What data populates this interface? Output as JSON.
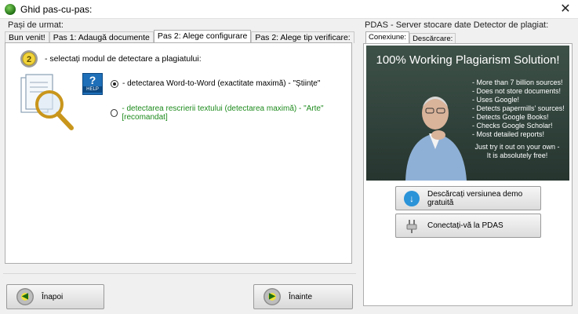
{
  "window": {
    "title": "Ghid pas-cu-pas:",
    "close_label": "✕"
  },
  "left": {
    "group_label": "Pași de urmat:",
    "tabs": [
      {
        "label": "Bun venit!"
      },
      {
        "label": "Pas 1: Adaugă documente"
      },
      {
        "label": "Pas 2: Alege configurare"
      },
      {
        "label": "Pas 2: Alege tip verificare:"
      }
    ],
    "active_tab": 2,
    "step_badge": "2",
    "step_text": "- selectați modul de detectare a plagiatului:",
    "help_label": "HELP",
    "help_glyph": "?",
    "options": [
      {
        "label": "- detectarea Word-to-Word (exactitate maximă) - \"Științe\"",
        "checked": true
      },
      {
        "label": "- detectarea rescrierii textului (detectarea maximă) - \"Arte\" [recomandat]",
        "checked": false
      }
    ],
    "accent_green": "#1c8a1c"
  },
  "nav": {
    "back_label": "Înapoi",
    "next_label": "Înainte",
    "back_icon": "arrow-left-icon",
    "next_icon": "arrow-right-icon"
  },
  "right": {
    "group_label": "PDAS - Server stocare date Detector de plagiat:",
    "tabs": [
      {
        "label": "Conexiune:"
      },
      {
        "label": "Descărcare:"
      }
    ],
    "active_tab": 0,
    "ad": {
      "title": "100% Working Plagiarism Solution!",
      "bullets": [
        "- More than 7 billion sources!",
        "- Does not store documents!",
        "- Uses Google!",
        "- Detects papermills' sources!",
        "- Detects Google Books!",
        "- Checks Google Scholar!",
        "- Most detailed reports!"
      ],
      "footer_line1": "Just try it out on your own -",
      "footer_line2": "It is absolutely free!"
    },
    "download_button": "Descărcați versiunea demo gratuită",
    "connect_button": "Conectați-vă la PDAS"
  }
}
